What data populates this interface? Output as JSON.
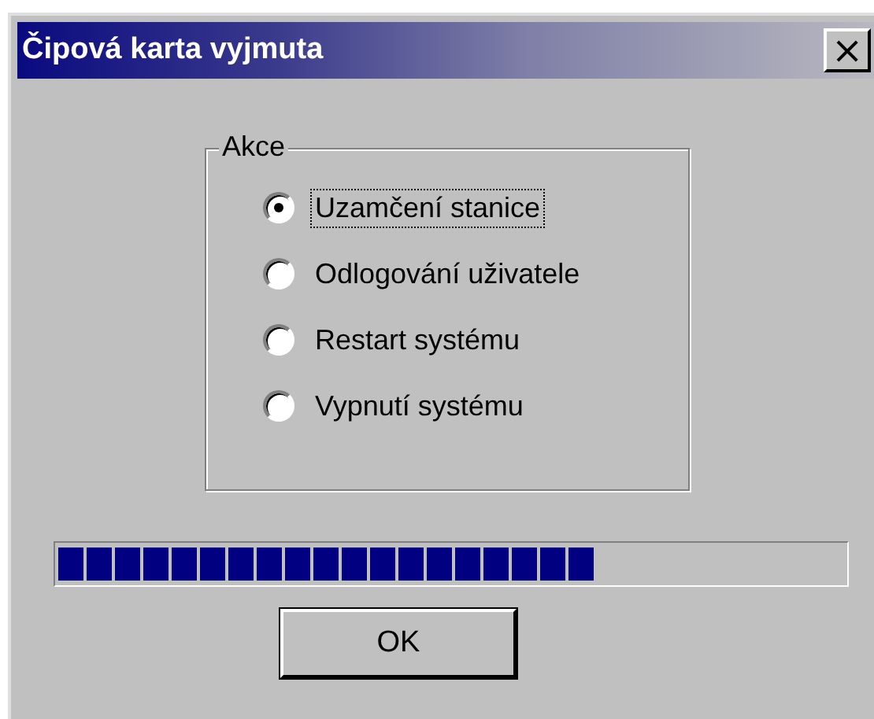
{
  "window": {
    "title": "Čipová karta vyjmuta",
    "close": "×"
  },
  "group": {
    "label": "Akce",
    "options": [
      {
        "label": "Uzamčení stanice",
        "selected": true
      },
      {
        "label": "Odlogování uživatele",
        "selected": false
      },
      {
        "label": "Restart systému",
        "selected": false
      },
      {
        "label": "Vypnutí systému",
        "selected": false
      }
    ]
  },
  "progress": {
    "level": 0.68
  },
  "buttons": [
    "OK"
  ]
}
